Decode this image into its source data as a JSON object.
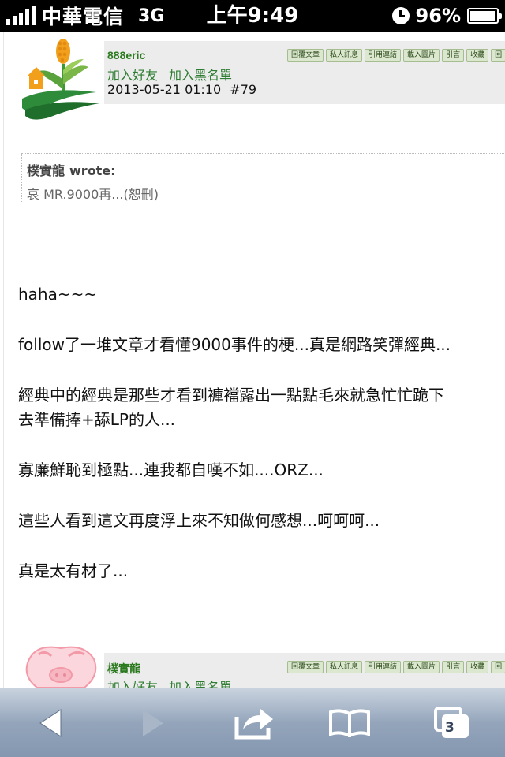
{
  "status_bar": {
    "carrier": "中華電信",
    "network": "3G",
    "time": "上午9:49",
    "battery": "96%"
  },
  "posts": [
    {
      "username": "888eric",
      "add_friend": "加入好友",
      "add_blacklist": "加入黑名單",
      "date": "2013-05-21 01:10",
      "floor": "#79",
      "actions": [
        "回覆文章",
        "私人訊息",
        "引用連結",
        "載入圖片",
        "引言",
        "收藏",
        "回"
      ],
      "quote": {
        "author": "樸實龍",
        "wrote": "wrote:",
        "text": "哀 MR.9000再...(恕刪)"
      },
      "body": [
        "haha~~~",
        "follow了一堆文章才看懂9000事件的梗...真是網路笑彈經典...",
        "經典中的經典是那些才看到褲襠露出一點點毛來就急忙忙跪下\n去準備捧+舔LP的人...",
        "寡廉鮮恥到極點...連我都自嘆不如....ORZ...",
        "這些人看到這文再度浮上來不知做何感想...呵呵呵...",
        "真是太有材了..."
      ]
    },
    {
      "username": "樸實龍",
      "add_friend": "加入好友",
      "add_blacklist": "加入黑名單",
      "actions": [
        "回覆文章",
        "私人訊息",
        "引用連結",
        "載入圖片",
        "引言",
        "收藏",
        "回"
      ]
    }
  ],
  "toolbar": {
    "back_icon": "back-arrow-icon",
    "forward_icon": "forward-arrow-icon",
    "share_icon": "share-icon",
    "bookmarks_icon": "bookmarks-icon",
    "tabs_icon": "tabs-icon",
    "tabs_count": "3"
  }
}
